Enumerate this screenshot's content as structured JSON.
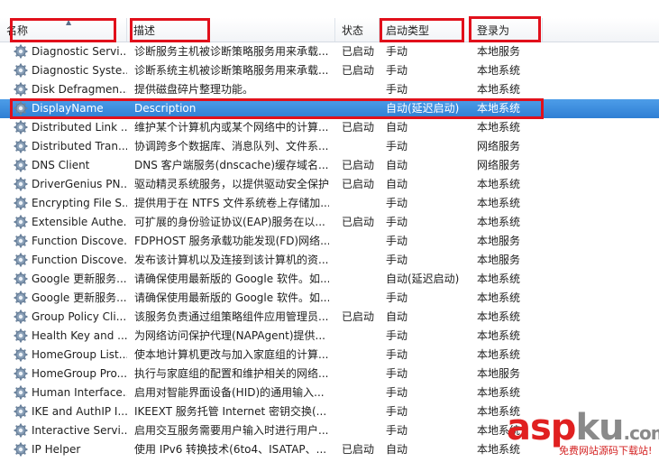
{
  "header": {
    "col_name": "名称",
    "col_desc": "描述",
    "col_status": "状态",
    "col_start": "启动类型",
    "col_logon": "登录为"
  },
  "rows": [
    {
      "name": "Diagnostic Servi...",
      "desc": "诊断服务主机被诊断策略服务用来承载...",
      "status": "已启动",
      "start": "手动",
      "logon": "本地服务"
    },
    {
      "name": "Diagnostic Syste...",
      "desc": "诊断系统主机被诊断策略服务用来承载...",
      "status": "已启动",
      "start": "手动",
      "logon": "本地系统"
    },
    {
      "name": "Disk Defragmen...",
      "desc": "提供磁盘碎片整理功能。",
      "status": "",
      "start": "手动",
      "logon": "本地系统"
    },
    {
      "name": "DisplayName",
      "desc": "Description",
      "status": "",
      "start": "自动(延迟启动)",
      "logon": "本地系统",
      "selected": true
    },
    {
      "name": "Distributed Link ...",
      "desc": "维护某个计算机内或某个网络中的计算...",
      "status": "已启动",
      "start": "自动",
      "logon": "本地系统"
    },
    {
      "name": "Distributed Tran...",
      "desc": "协调跨多个数据库、消息队列、文件系...",
      "status": "",
      "start": "手动",
      "logon": "网络服务"
    },
    {
      "name": "DNS Client",
      "desc": "DNS 客户端服务(dnscache)缓存域名...",
      "status": "已启动",
      "start": "自动",
      "logon": "网络服务"
    },
    {
      "name": "DriverGenius PN...",
      "desc": "驱动精灵系统服务，以提供驱动安全保护...",
      "status": "已启动",
      "start": "自动",
      "logon": "本地系统"
    },
    {
      "name": "Encrypting File S...",
      "desc": "提供用于在 NTFS 文件系统卷上存储加...",
      "status": "",
      "start": "手动",
      "logon": "本地系统"
    },
    {
      "name": "Extensible Authe...",
      "desc": "可扩展的身份验证协议(EAP)服务在以...",
      "status": "已启动",
      "start": "手动",
      "logon": "本地系统"
    },
    {
      "name": "Function Discove...",
      "desc": "FDPHOST 服务承载功能发现(FD)网络...",
      "status": "",
      "start": "手动",
      "logon": "本地服务"
    },
    {
      "name": "Function Discove...",
      "desc": "发布该计算机以及连接到该计算机的资...",
      "status": "",
      "start": "手动",
      "logon": "本地服务"
    },
    {
      "name": "Google 更新服务...",
      "desc": "请确保使用最新版的 Google 软件。如...",
      "status": "",
      "start": "自动(延迟启动)",
      "logon": "本地系统"
    },
    {
      "name": "Google 更新服务...",
      "desc": "请确保使用最新版的 Google 软件。如...",
      "status": "",
      "start": "手动",
      "logon": "本地系统"
    },
    {
      "name": "Group Policy Cli...",
      "desc": "该服务负责通过组策略组件应用管理员...",
      "status": "已启动",
      "start": "自动",
      "logon": "本地系统"
    },
    {
      "name": "Health Key and ...",
      "desc": "为网络访问保护代理(NAPAgent)提供...",
      "status": "",
      "start": "手动",
      "logon": "本地系统"
    },
    {
      "name": "HomeGroup List...",
      "desc": "使本地计算机更改与加入家庭组的计算...",
      "status": "",
      "start": "手动",
      "logon": "本地系统"
    },
    {
      "name": "HomeGroup Pro...",
      "desc": "执行与家庭组的配置和维护相关的网络...",
      "status": "",
      "start": "手动",
      "logon": "本地服务"
    },
    {
      "name": "Human Interface...",
      "desc": "启用对智能界面设备(HID)的通用输入...",
      "status": "",
      "start": "手动",
      "logon": "本地系统"
    },
    {
      "name": "IKE and AuthIP I...",
      "desc": "IKEEXT 服务托管 Internet 密钥交换(...",
      "status": "",
      "start": "手动",
      "logon": "本地系统"
    },
    {
      "name": "Interactive Servi...",
      "desc": "启用交互服务需要用户输入时进行用户...",
      "status": "",
      "start": "手动",
      "logon": "本地系统"
    },
    {
      "name": "IP Helper",
      "desc": "使用 IPv6 转换技术(6to4、ISATAP、...",
      "status": "已启动",
      "start": "自动",
      "logon": "本地系统"
    }
  ],
  "watermark": {
    "brand_a": "asp",
    "brand_b": "ku",
    "brand_tld": ".com",
    "tagline": "免费网站源码下载站!"
  },
  "colors": {
    "selection": "#3a8ddd",
    "highlight_box": "#e1101b"
  },
  "icons": {
    "service": "gear-icon",
    "sort": "sort-ascending-icon"
  }
}
